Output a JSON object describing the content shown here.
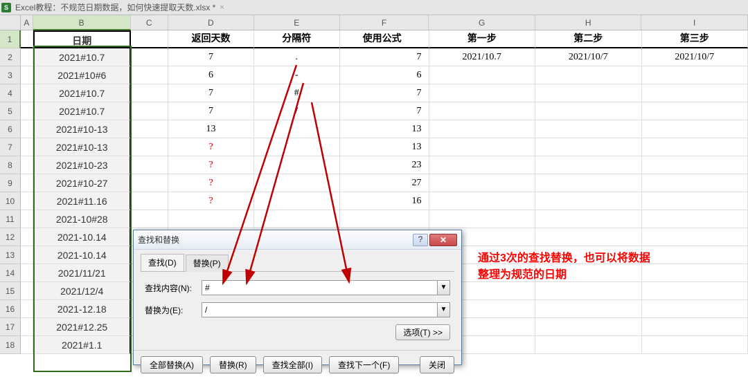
{
  "tabbar": {
    "filename": "Excel教程：不规范日期数据，如何快速提取天数.xlsx *",
    "close_glyph": "×"
  },
  "columns": [
    "A",
    "B",
    "C",
    "D",
    "E",
    "F",
    "G",
    "H",
    "I"
  ],
  "headers": {
    "B": "日期",
    "D": "返回天数",
    "E": "分隔符",
    "F": "使用公式",
    "G": "第一步",
    "H": "第二步",
    "I": "第三步"
  },
  "rows": [
    {
      "n": 2,
      "B": "2021#10.7",
      "D": "7",
      "E": ".",
      "F": "7",
      "G": "2021/10.7",
      "H": "2021/10/7",
      "I": "2021/10/7"
    },
    {
      "n": 3,
      "B": "2021#10#6",
      "D": "6",
      "E": "-",
      "F": "6",
      "G": "",
      "H": "",
      "I": ""
    },
    {
      "n": 4,
      "B": "2021#10.7",
      "D": "7",
      "E": "#",
      "F": "7",
      "G": "",
      "H": "",
      "I": ""
    },
    {
      "n": 5,
      "B": "2021#10.7",
      "D": "7",
      "E": "/",
      "F": "7",
      "G": "",
      "H": "",
      "I": ""
    },
    {
      "n": 6,
      "B": "2021#10-13",
      "D": "13",
      "E": "",
      "F": "13",
      "G": "",
      "H": "",
      "I": ""
    },
    {
      "n": 7,
      "B": "2021#10-13",
      "D": "?",
      "Dred": true,
      "E": "",
      "F": "13",
      "G": "",
      "H": "",
      "I": ""
    },
    {
      "n": 8,
      "B": "2021#10-23",
      "D": "?",
      "Dred": true,
      "E": "",
      "F": "23",
      "G": "",
      "H": "",
      "I": ""
    },
    {
      "n": 9,
      "B": "2021#10-27",
      "D": "?",
      "Dred": true,
      "E": "",
      "F": "27",
      "G": "",
      "H": "",
      "I": ""
    },
    {
      "n": 10,
      "B": "2021#11.16",
      "D": "?",
      "Dred": true,
      "E": "",
      "F": "16",
      "G": "",
      "H": "",
      "I": ""
    },
    {
      "n": 11,
      "B": "2021-10#28",
      "D": "",
      "E": "",
      "F": "",
      "G": "",
      "H": "",
      "I": ""
    },
    {
      "n": 12,
      "B": "2021-10.14",
      "D": "",
      "E": "",
      "F": "",
      "G": "",
      "H": "",
      "I": ""
    },
    {
      "n": 13,
      "B": "2021-10.14",
      "D": "",
      "E": "",
      "F": "",
      "G": "",
      "H": "",
      "I": ""
    },
    {
      "n": 14,
      "B": "2021/11/21",
      "D": "",
      "E": "",
      "F": "",
      "G": "",
      "H": "",
      "I": ""
    },
    {
      "n": 15,
      "B": "2021/12/4",
      "D": "",
      "E": "",
      "F": "",
      "G": "",
      "H": "",
      "I": ""
    },
    {
      "n": 16,
      "B": "2021-12.18",
      "D": "",
      "E": "",
      "F": "",
      "G": "",
      "H": "",
      "I": ""
    },
    {
      "n": 17,
      "B": "2021#12.25",
      "D": "",
      "E": "",
      "F": "",
      "G": "",
      "H": "",
      "I": ""
    },
    {
      "n": 18,
      "B": "2021#1.1",
      "D": "",
      "E": "",
      "F": "",
      "G": "",
      "H": "",
      "I": ""
    }
  ],
  "dialog": {
    "title": "查找和替换",
    "help_glyph": "?",
    "close_glyph": "✕",
    "tab_find": "查找(D)",
    "tab_replace": "替换(P)",
    "label_find": "查找内容(N):",
    "label_replace": "替换为(E):",
    "value_find": "#",
    "value_replace": "/",
    "options_btn": "选项(T) >>",
    "btn_replace_all": "全部替换(A)",
    "btn_replace": "替换(R)",
    "btn_find_all": "查找全部(I)",
    "btn_find_next": "查找下一个(F)",
    "btn_close": "关闭"
  },
  "annotation": {
    "line1": "通过3次的查找替换，也可以将数据",
    "line2": "整理为规范的日期"
  }
}
